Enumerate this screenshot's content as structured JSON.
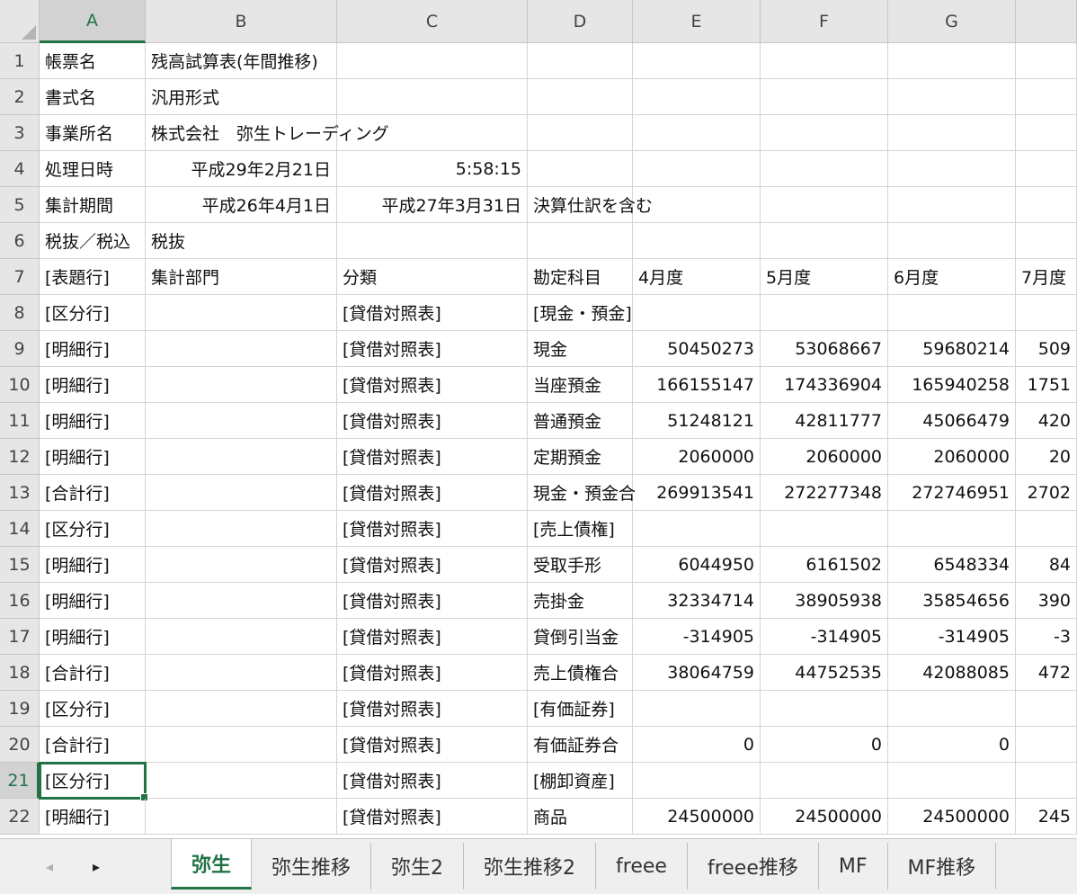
{
  "columns": [
    "A",
    "B",
    "C",
    "D",
    "E",
    "F",
    "G",
    ""
  ],
  "selected_column": "A",
  "selected_row": "21",
  "rows": [
    {
      "num": "1",
      "cells": [
        "帳票名",
        "残高試算表(年間推移)",
        "",
        "",
        "",
        "",
        "",
        ""
      ]
    },
    {
      "num": "2",
      "cells": [
        "書式名",
        "汎用形式",
        "",
        "",
        "",
        "",
        "",
        ""
      ]
    },
    {
      "num": "3",
      "cells": [
        "事業所名",
        "株式会社　弥生トレーディング",
        "",
        "",
        "",
        "",
        "",
        ""
      ]
    },
    {
      "num": "4",
      "cells": [
        "処理日時",
        "平成29年2月21日",
        "5:58:15",
        "",
        "",
        "",
        "",
        ""
      ]
    },
    {
      "num": "5",
      "cells": [
        "集計期間",
        "平成26年4月1日",
        "平成27年3月31日",
        "決算仕訳を含む",
        "",
        "",
        "",
        ""
      ]
    },
    {
      "num": "6",
      "cells": [
        "税抜／税込",
        "税抜",
        "",
        "",
        "",
        "",
        "",
        ""
      ]
    },
    {
      "num": "7",
      "cells": [
        "[表題行]",
        "集計部門",
        "分類",
        "勘定科目",
        "4月度",
        "5月度",
        "6月度",
        "7月度"
      ]
    },
    {
      "num": "8",
      "cells": [
        "[区分行]",
        "",
        "[貸借対照表]",
        "[現金・預金]",
        "",
        "",
        "",
        ""
      ]
    },
    {
      "num": "9",
      "cells": [
        "[明細行]",
        "",
        "[貸借対照表]",
        "現金",
        "50450273",
        "53068667",
        "59680214",
        "509"
      ]
    },
    {
      "num": "10",
      "cells": [
        "[明細行]",
        "",
        "[貸借対照表]",
        "当座預金",
        "166155147",
        "174336904",
        "165940258",
        "1751"
      ]
    },
    {
      "num": "11",
      "cells": [
        "[明細行]",
        "",
        "[貸借対照表]",
        "普通預金",
        "51248121",
        "42811777",
        "45066479",
        "420"
      ]
    },
    {
      "num": "12",
      "cells": [
        "[明細行]",
        "",
        "[貸借対照表]",
        "定期預金",
        "2060000",
        "2060000",
        "2060000",
        "20"
      ]
    },
    {
      "num": "13",
      "cells": [
        "[合計行]",
        "",
        "[貸借対照表]",
        "現金・預金合",
        "269913541",
        "272277348",
        "272746951",
        "2702"
      ]
    },
    {
      "num": "14",
      "cells": [
        "[区分行]",
        "",
        "[貸借対照表]",
        "[売上債権]",
        "",
        "",
        "",
        ""
      ]
    },
    {
      "num": "15",
      "cells": [
        "[明細行]",
        "",
        "[貸借対照表]",
        "受取手形",
        "6044950",
        "6161502",
        "6548334",
        "84"
      ]
    },
    {
      "num": "16",
      "cells": [
        "[明細行]",
        "",
        "[貸借対照表]",
        "売掛金",
        "32334714",
        "38905938",
        "35854656",
        "390"
      ]
    },
    {
      "num": "17",
      "cells": [
        "[明細行]",
        "",
        "[貸借対照表]",
        "貸倒引当金",
        "-314905",
        "-314905",
        "-314905",
        "-3"
      ]
    },
    {
      "num": "18",
      "cells": [
        "[合計行]",
        "",
        "[貸借対照表]",
        "売上債権合",
        "38064759",
        "44752535",
        "42088085",
        "472"
      ]
    },
    {
      "num": "19",
      "cells": [
        "[区分行]",
        "",
        "[貸借対照表]",
        "[有価証券]",
        "",
        "",
        "",
        ""
      ]
    },
    {
      "num": "20",
      "cells": [
        "[合計行]",
        "",
        "[貸借対照表]",
        "有価証券合",
        "0",
        "0",
        "0",
        ""
      ]
    },
    {
      "num": "21",
      "cells": [
        "[区分行]",
        "",
        "[貸借対照表]",
        "[棚卸資産]",
        "",
        "",
        "",
        ""
      ]
    },
    {
      "num": "22",
      "cells": [
        "[明細行]",
        "",
        "[貸借対照表]",
        "商品",
        "24500000",
        "24500000",
        "24500000",
        "245"
      ]
    }
  ],
  "sheet_tabs": [
    "弥生",
    "弥生推移",
    "弥生2",
    "弥生推移2",
    "freee",
    "freee推移",
    "MF",
    "MF推移"
  ],
  "active_tab": "弥生",
  "accent_color": "#217346",
  "nav_icons": [
    "scroll-left-icon",
    "scroll-right-icon"
  ]
}
